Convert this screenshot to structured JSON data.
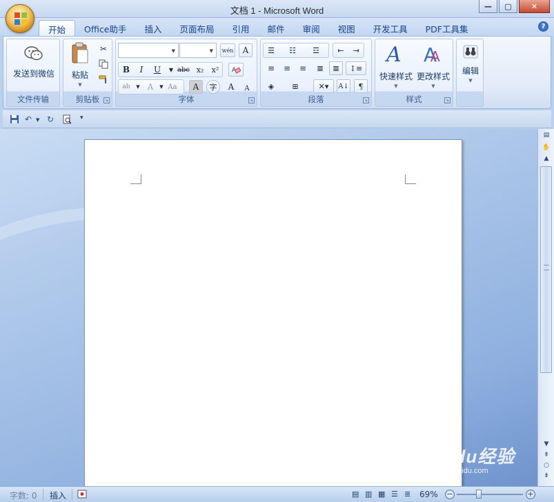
{
  "window": {
    "title": "文档 1 - Microsoft Word",
    "minimize_glyph": "—",
    "maximize_glyph": "▢",
    "close_glyph": "✕"
  },
  "tabs": [
    {
      "label": "开始",
      "active": true
    },
    {
      "label": "Office助手"
    },
    {
      "label": "插入"
    },
    {
      "label": "页面布局"
    },
    {
      "label": "引用"
    },
    {
      "label": "邮件"
    },
    {
      "label": "审阅"
    },
    {
      "label": "视图"
    },
    {
      "label": "开发工具"
    },
    {
      "label": "PDF工具集"
    }
  ],
  "help_glyph": "?",
  "ribbon": {
    "groups": {
      "wechat": {
        "label": "文件传输",
        "button": "发送到微信"
      },
      "clipboard": {
        "label": "剪贴板",
        "paste": "粘贴"
      },
      "font": {
        "label": "字体",
        "font_name": "",
        "font_size": ""
      },
      "paragraph": {
        "label": "段落"
      },
      "styles": {
        "label": "样式",
        "quick_styles": "快速样式",
        "change_styles": "更改样式"
      },
      "editing": {
        "label": "编辑",
        "button": "编辑"
      }
    },
    "font_buttons": {
      "bold": "B",
      "italic": "I",
      "underline": "U",
      "strike": "abc",
      "subscript": "x₂",
      "superscript": "x²",
      "grow": "A",
      "shrink": "A",
      "aa": "Aa",
      "char_border": "A",
      "phonetic": "wén"
    }
  },
  "statusbar": {
    "word_count": "字数: 0",
    "insert_mode": "插入",
    "zoom": "69%",
    "zoom_minus": "−",
    "zoom_plus": "+"
  },
  "watermark": {
    "main": "Baidu经验",
    "sub": "jingyan.baidu.com"
  },
  "colors": {
    "ribbon_bg": "#e1ebf8",
    "tab_text": "#15428b",
    "doc_bg": "#8fb0df",
    "page": "#ffffff"
  }
}
